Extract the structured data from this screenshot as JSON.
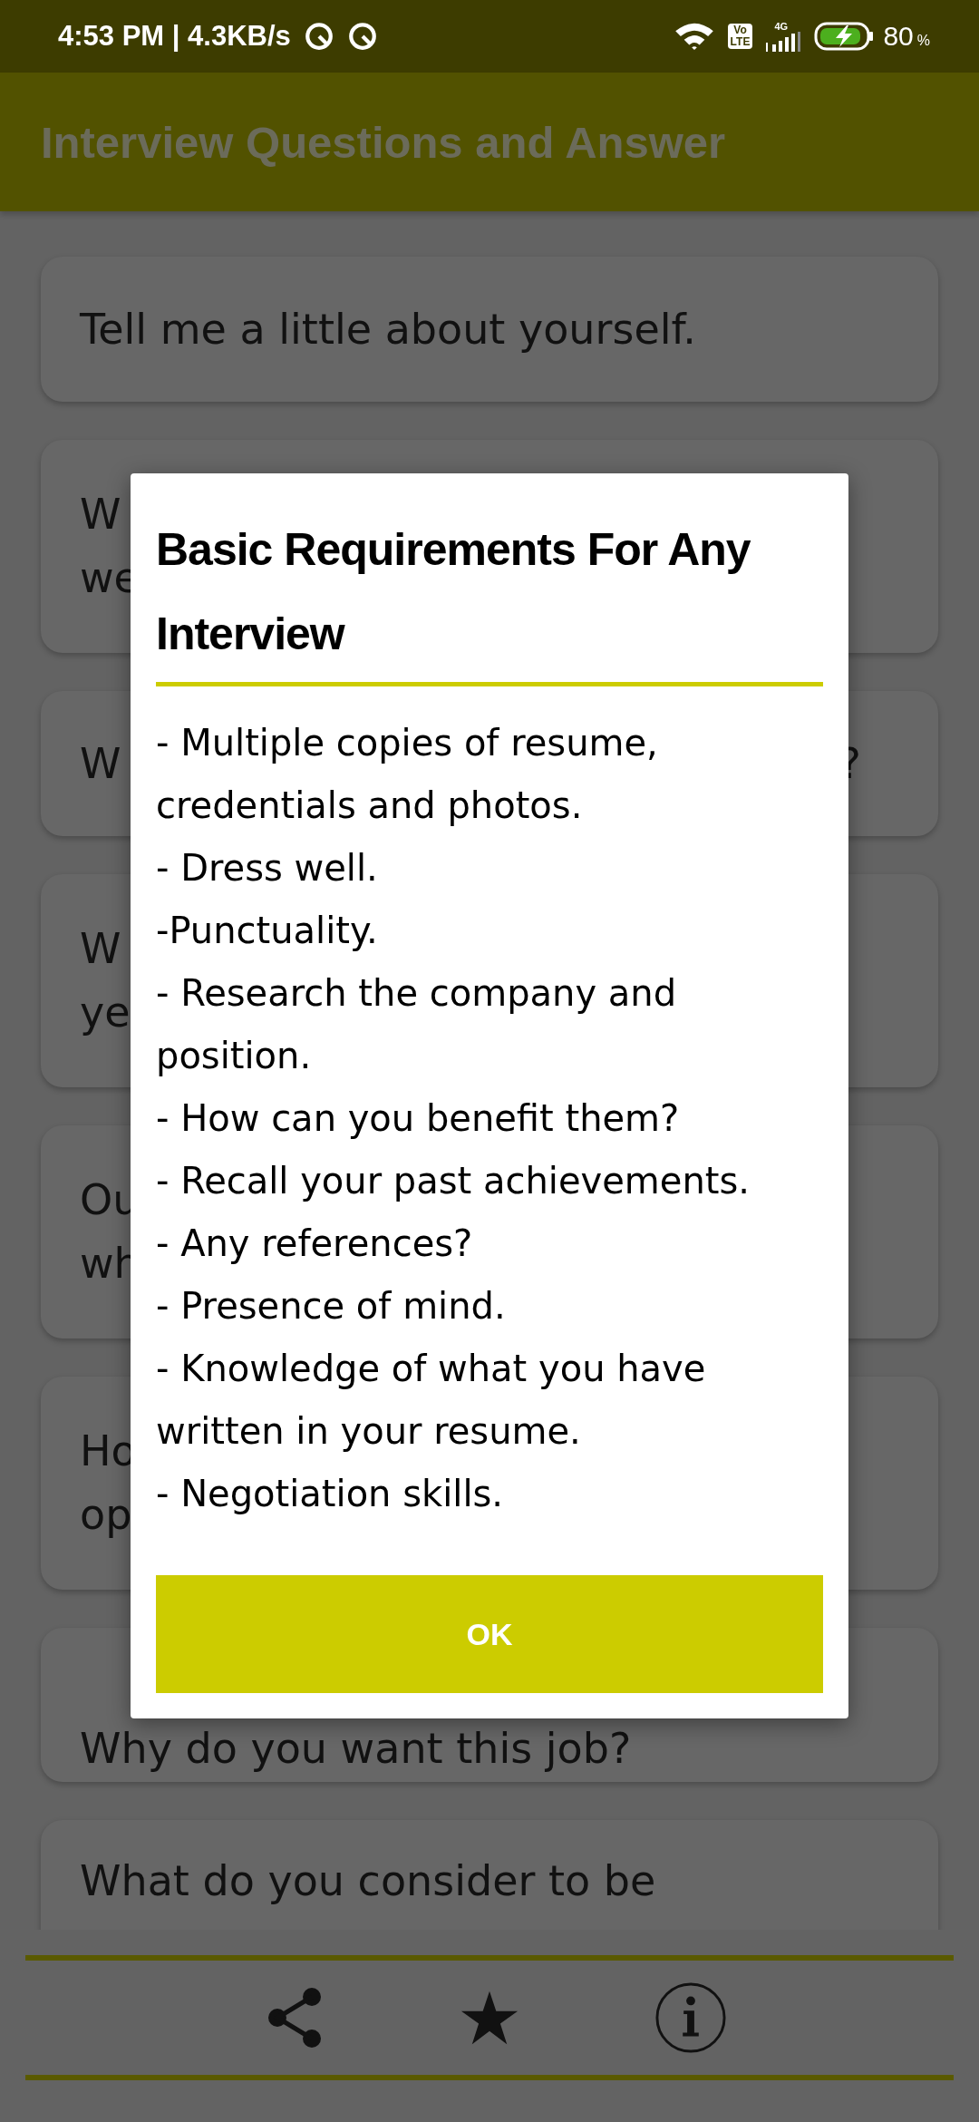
{
  "status_bar": {
    "time": "4:53 PM | 4.3KB/s",
    "volte_top": "Vo",
    "volte_bottom": "LTE",
    "network": "4G",
    "battery": "80",
    "battery_unit": "%"
  },
  "app_bar": {
    "title": "Interview Questions and Answer"
  },
  "cards": [
    {
      "lines": [
        {
          "left": "Tell me a little about yourself."
        }
      ]
    },
    {
      "lines": [
        {
          "left": "W"
        },
        {
          "left": "we"
        }
      ]
    },
    {
      "lines": [
        {
          "left": "W",
          "right": "?"
        }
      ]
    },
    {
      "lines": [
        {
          "left": "W"
        },
        {
          "left": "ye"
        }
      ]
    },
    {
      "lines": [
        {
          "left": "Ou"
        },
        {
          "left": "wh"
        }
      ]
    },
    {
      "lines": [
        {
          "left": "Ho"
        },
        {
          "left": "op"
        }
      ]
    },
    {
      "lines": [
        {
          "left": "Why do you want this job?"
        }
      ]
    },
    {
      "lines": [
        {
          "left": "What do you consider to be"
        }
      ]
    }
  ],
  "dialog": {
    "title": "Basic Requirements For Any Interview",
    "items": [
      "-  Multiple copies of resume, credentials and photos.",
      "- Dress well.",
      "-Punctuality.",
      "- Research the company and position.",
      "- How can you benefit them?",
      "- Recall your past achievements.",
      "- Any references?",
      "- Presence of mind.",
      "- Knowledge of what you have written in your resume.",
      "- Negotiation skills."
    ],
    "button": "OK"
  }
}
